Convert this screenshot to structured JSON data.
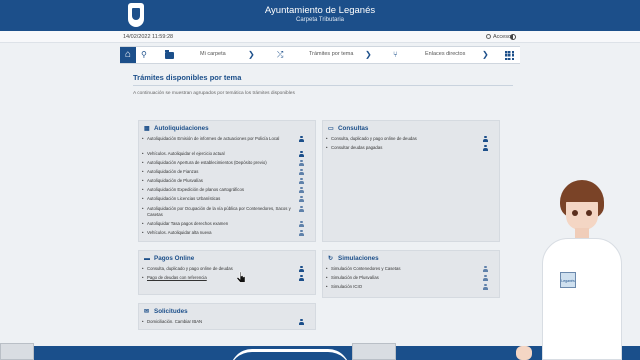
{
  "header": {
    "title": "Ayuntamiento de Leganés",
    "subtitle": "Carpeta Tributaria"
  },
  "infobar": {
    "datetime": "14/02/2022 11:59:28",
    "access_label": "Acceso"
  },
  "nav": {
    "items": [
      {
        "label": "Mi carpeta",
        "icon": "folder-icon"
      },
      {
        "label": "Trámites por tema",
        "icon": "shuffle-icon"
      },
      {
        "label": "Enlaces directos",
        "icon": "branch-icon"
      }
    ],
    "home_icon": "home-icon",
    "search_icon": "search-icon",
    "menu_icon": "grid-icon"
  },
  "page": {
    "title": "Trámites disponibles por tema",
    "description": "A continuación se muestran agrupados por temática los trámites disponibles"
  },
  "cards": {
    "autoliquidaciones": {
      "title": "Autoliquidaciones",
      "icon": "calculator-icon",
      "items": [
        "Autoliquidación Emisión de informes de actuaciones por Policía Local",
        "Vehículos. Autoliquidar el ejercicio actual",
        "Autoliquidación Apertura de establecimientos (Depósito previo)",
        "Autoliquidación de Fianzas",
        "Autoliquidación de Plusvalías",
        "Autoliquidación Expedición de planos cartográficos",
        "Autoliquidación Licencias Urbanísticas",
        "Autoliquidación por Ocupación de la vía pública por Contenedores, Sacos y Casetas",
        "Autoliquidar Tasa pagos derechos examen",
        "Vehículos. Autoliquidar alta nueva"
      ]
    },
    "consultas": {
      "title": "Consultas",
      "icon": "chat-icon",
      "items": [
        "Consulta, duplicado y pago online de deudas",
        "Consultar deudas pagadas"
      ]
    },
    "pagos": {
      "title": "Pagos Online",
      "icon": "card-icon",
      "items": [
        "Consulta, duplicado y pago online de deudas",
        "Pago de deudas con referencia"
      ]
    },
    "simulaciones": {
      "title": "Simulaciones",
      "icon": "refresh-icon",
      "items": [
        "Simulación Contenedores y Casetas",
        "Simulación de Plusvalías",
        "Simulación ICIO"
      ]
    },
    "solicitudes": {
      "title": "Solicitudes",
      "icon": "envelope-icon",
      "items": [
        "Domiciliación. Cambiar IBAN"
      ]
    }
  },
  "avatar": {
    "shirt_text": "Leganés"
  },
  "colors": {
    "primary": "#1c4f8a",
    "background": "#eef1f4",
    "card": "#e3e6ea"
  }
}
